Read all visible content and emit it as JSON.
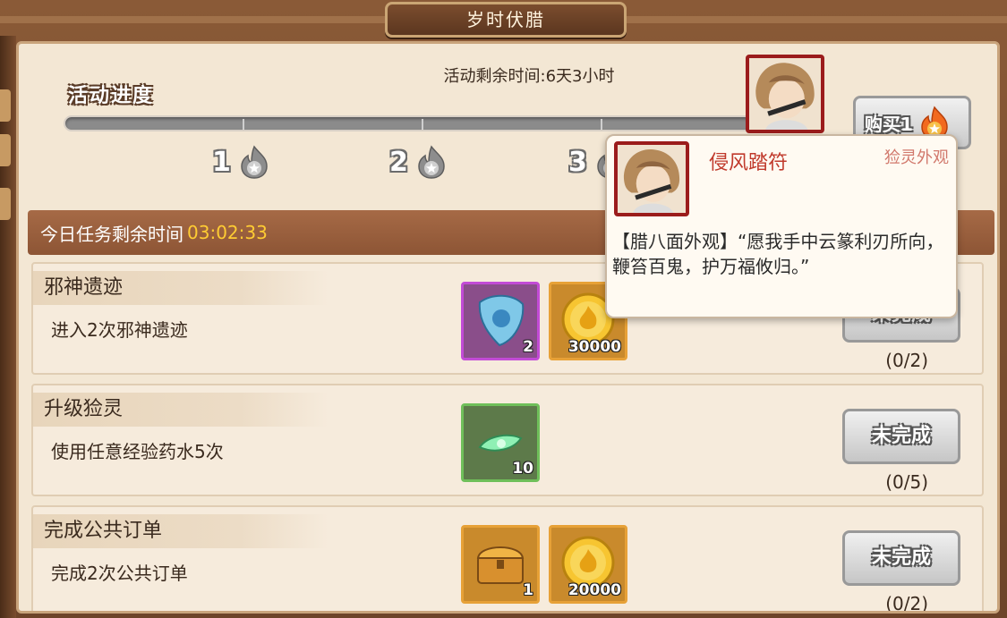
{
  "window": {
    "title": "岁时伏腊"
  },
  "event": {
    "remaining_time_label": "活动剩余时间:6天3小时",
    "progress_title": "活动进度",
    "progress_fraction": 0.0,
    "milestones": [
      {
        "label": "1",
        "icon": "gray-flame-star-icon"
      },
      {
        "label": "2",
        "icon": "gray-flame-star-icon"
      },
      {
        "label": "3",
        "icon": "gray-flame-star-icon"
      }
    ],
    "buy_button_label": "购买1"
  },
  "daily": {
    "label": "今日任务剩余时间",
    "time": "03:02:33"
  },
  "tasks": [
    {
      "name": "邪神遗迹",
      "desc": "进入2次邪神遗迹",
      "rewards": [
        {
          "icon": "blue-crystal-icon",
          "count": "2",
          "rarity": "purple"
        },
        {
          "icon": "gold-coin-icon",
          "count": "30000",
          "rarity": "orange"
        }
      ],
      "status": "未完成",
      "progress": "(0/2)"
    },
    {
      "name": "升级猃灵",
      "desc": "使用任意经验药水5次",
      "rewards": [
        {
          "icon": "green-potion-icon",
          "count": "10",
          "rarity": "green"
        }
      ],
      "status": "未完成",
      "progress": "(0/5)"
    },
    {
      "name": "完成公共订单",
      "desc": "完成2次公共订单",
      "rewards": [
        {
          "icon": "treasure-chest-icon",
          "count": "1",
          "rarity": "orange"
        },
        {
          "icon": "gold-coin-icon",
          "count": "20000",
          "rarity": "orange"
        }
      ],
      "status": "未完成",
      "progress": "(0/2)"
    }
  ],
  "tooltip": {
    "name": "侵风踏符",
    "type": "猃灵外观",
    "text": "【腊八面外观】“愿我手中云篆利刃所向，鞭笞百鬼，护万福攸归。”"
  },
  "colors": {
    "accent_time": "#ffcc33",
    "frame": "#9b1c1c",
    "tooltip_name": "#c0392b"
  }
}
